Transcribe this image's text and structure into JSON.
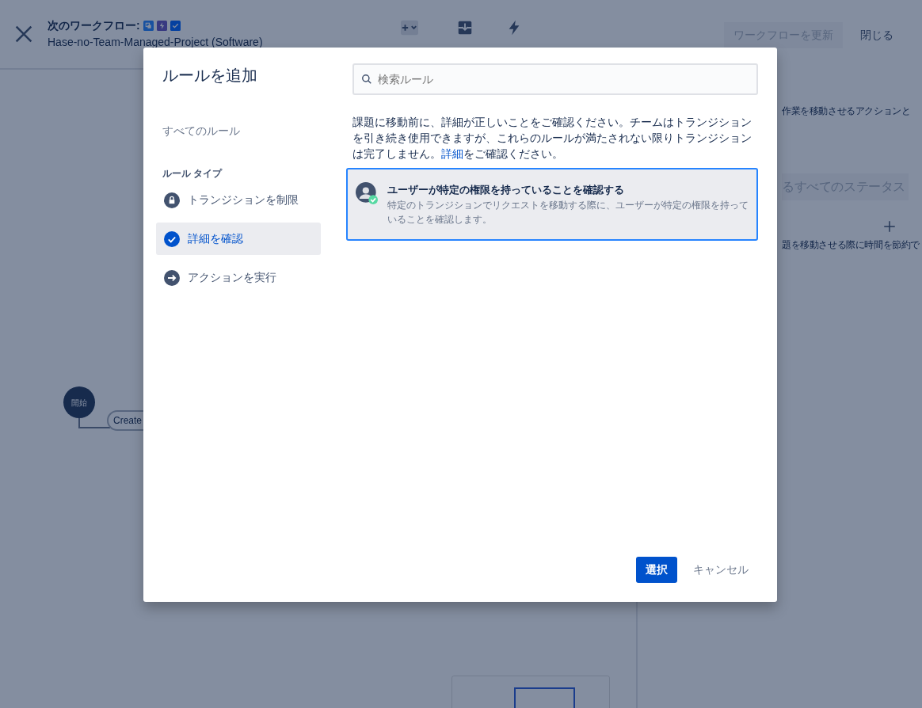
{
  "header": {
    "title": "次のワークフロー:",
    "title_icons": [
      {
        "kind": "copy"
      },
      {
        "kind": "bolt"
      },
      {
        "kind": "check"
      }
    ],
    "project": "Hase-no-Team-Managed-Project (Software)"
  },
  "toolbar": [
    {
      "kind": "status"
    },
    {
      "kind": "transition"
    },
    {
      "kind": "rule"
    }
  ],
  "header_buttons": [
    {
      "label": "ワークフローを更新",
      "disabled": true
    },
    {
      "label": "閉じる",
      "disabled": false
    }
  ],
  "canvas": {
    "start_node": "開始",
    "transition": "Create"
  },
  "side_panel": {
    "text_1": "作業を移動させるアクションと",
    "status_button": "るすべてのステータス",
    "text_2": "題を移動させる際に時間を節約で"
  },
  "modal": {
    "title": "ルールを追加",
    "search": {
      "placeholder": "検索ルール"
    },
    "all_rules": "すべてのルール",
    "section": "ルール タイプ",
    "rule_types": [
      {
        "label": "トランジションを制限",
        "kind": "lock",
        "selected": false
      },
      {
        "label": "詳細を確認",
        "kind": "check",
        "selected": true
      },
      {
        "label": "アクションを実行",
        "kind": "arrow",
        "selected": false
      }
    ],
    "description": {
      "before": "課題に移動前に、詳細が正しいことをご確認ください。チームはトランジションを引き続き使用できますが、これらのルールが満たされない限りトランジションは完了しません。",
      "link": "詳細",
      "after": "をご確認ください。"
    },
    "rules": [
      {
        "title": "ユーザーが特定の権限を持っていることを確認する",
        "description": "特定のトランジションでリクエストを移動する際に、ユーザーが特定の権限を持っていることを確認します。",
        "selected": true
      }
    ],
    "buttons": [
      {
        "label": "選択",
        "kind": "primary"
      },
      {
        "label": "キャンセル",
        "kind": "subtle"
      }
    ]
  }
}
